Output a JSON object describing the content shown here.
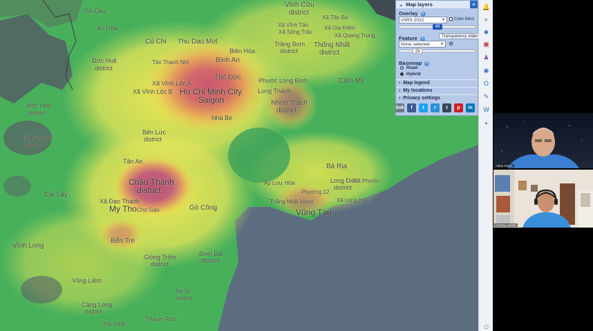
{
  "panel": {
    "title": "Map layers",
    "overlay_label": "Overlay",
    "overlay_value": "VIIRS 2022",
    "color_blind_label": "Color blind",
    "overlay_slider": "49",
    "transparency_label": "Transparency slider",
    "feature_label": "Feature",
    "feature_value": "None selected",
    "feature_slider": "23",
    "basemap_label": "Basemap",
    "basemap_options": [
      "Road",
      "Hybrid"
    ],
    "basemap_selected": "Hybrid",
    "sections": [
      "Map legend",
      "My locations",
      "Privacy settings"
    ]
  },
  "share": [
    "link",
    "f",
    "t",
    "r",
    "t",
    "p",
    "in"
  ],
  "map_places": {
    "go_dau": "Gò Dầu",
    "an_hoa": "An Hòa",
    "cu_chi": "Củ Chi",
    "thu_dau_mot": "Thu Dau Mot",
    "vinh_cuu": "Vĩnh Cửu",
    "vinh_cuu_d": "district",
    "xa_tan_ba": "Xã Tân Ba",
    "xa_vinh_tan": "Xã Vĩnh Tân",
    "xa_song_trau": "Xã Sông Trầu",
    "xa_gia_kiem": "Xã Gia Kiệm",
    "xa_quang_trung": "Xã Quang Trung",
    "trang_bom": "Trảng Bom",
    "trang_bom_d": "district",
    "thong_nhat": "Thống Nhất",
    "thong_nhat_d": "district",
    "bien_hoa": "Biên Hòa",
    "binh_an": "Bình An",
    "thu_duc": "Thủ Đức",
    "duc_hue": "Đức Huệ",
    "duc_hue_d": "district",
    "tan_thanh_nhi": "Tân Thạnh Nhì",
    "xa_vinh_loc_a": "Xã Vĩnh Lộc A",
    "xa_vinh_loc_b": "Xã Vĩnh Lộc B",
    "hcmc": "Ho Chi Minh City",
    "saigon": "Saigon",
    "phuoc_long": "Phước Long Bình",
    "long_thanh": "Long Thành",
    "cam_my": "Cẩm Mỹ",
    "moc_hoa": "Mộc Hóa",
    "moc_hoa_d": "district",
    "nhon_trach": "Nhơn Trạch",
    "nhon_trach_d": "district",
    "nha_be": "Nhà Bè",
    "ben_luc": "Bến Lức",
    "ben_luc_d": "district",
    "tan_thanh": "Tân Thạnh",
    "tan_thanh_d": "district",
    "tan_an": "Tân An",
    "chau_thanh": "Châu Thành",
    "chau_thanh_d": "district",
    "cai_lay": "Cai Lậy",
    "xa_dao_thanh": "Xã Đạo Thạnh",
    "my_tho": "My Tho",
    "cho_gao": "Chợ Gạo",
    "go_cong": "Gò Công",
    "ba_ria": "Bà Rịa",
    "long_dien": "Long Điền",
    "long_dien_d": "district",
    "ap_luc": "Ấp Lưu",
    "hoa": "Hòa",
    "phuong_12": "Phường 12",
    "thang_nhat": "Thắng Nhất Ward",
    "xa_long_hai": "Xã Long Hải",
    "vung_tau": "Vũng Tàu",
    "xa_phuoc": "Xã Phước",
    "ben_tre": "Bến Tre",
    "vinh_long": "Vĩnh Long",
    "giong_trom": "Giồng Trôm",
    "giong_trom_d": "district",
    "binh_dai": "Bình Đại",
    "binh_dai_d": "district",
    "vung_liem": "Vũng Liêm",
    "cang_long": "Càng Long",
    "cang_long_d": "district",
    "ba_tri": "Ba Tri",
    "ba_tri_d": "district",
    "tra_vinh": "Trà Vinh",
    "thanh_phu": "Thạnh Phú"
  },
  "video": {
    "top_name": "Fabio Falchi",
    "bottom_name": "Christy Levitan"
  },
  "colors": {
    "panel_bg": "#b6c9e8",
    "accent": "#1d57b8",
    "sea": "#5c6d80"
  }
}
